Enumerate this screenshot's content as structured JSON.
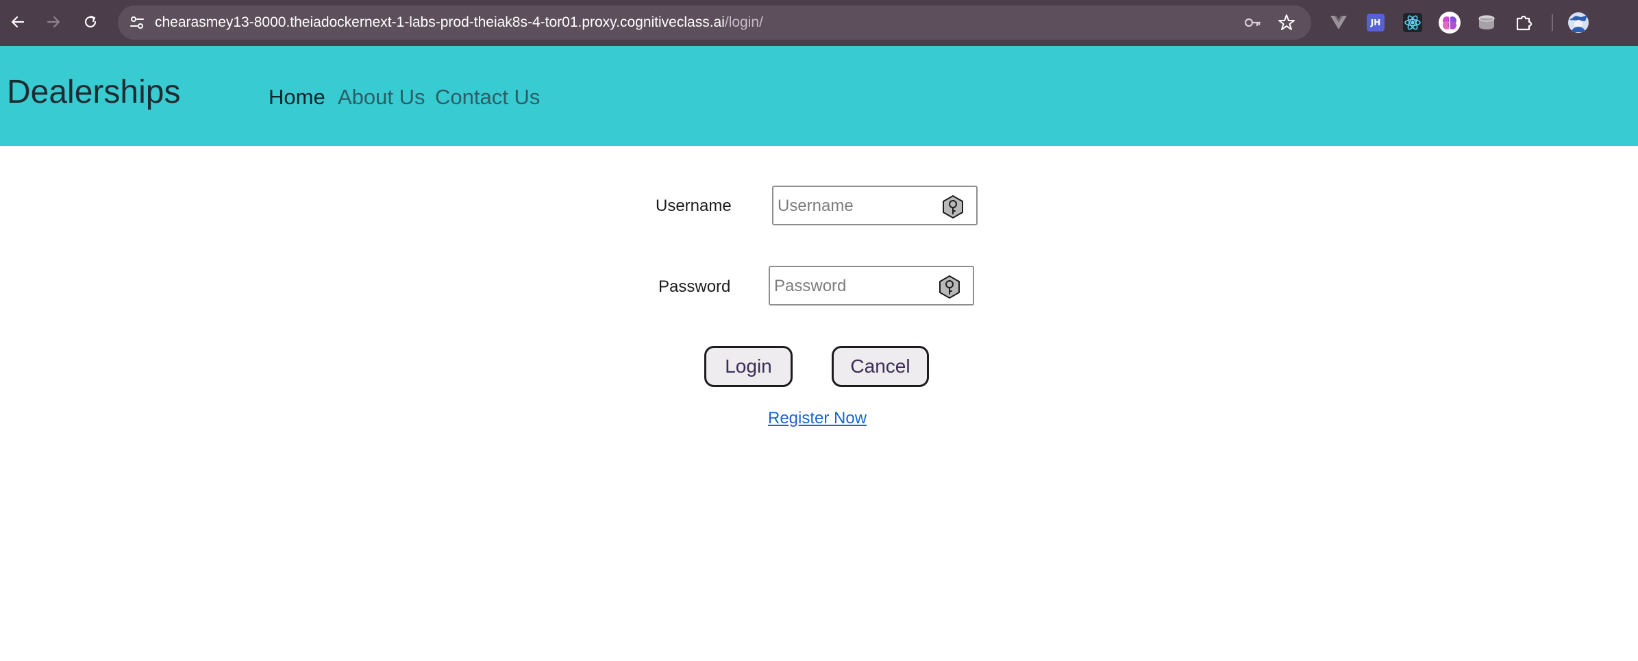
{
  "browser": {
    "url_host": "chearasmey13-8000.theiadockernext-1-labs-prod-theiak8s-4-tor01.proxy.cognitiveclass.ai",
    "url_path": "/login/",
    "icons": [
      "back-icon",
      "forward-icon",
      "reload-icon",
      "site-info-icon",
      "password-key-icon",
      "bookmark-star-icon",
      "vue-devtools-icon",
      "jh-extension-icon",
      "react-devtools-icon",
      "brain-extension-icon",
      "database-extension-icon",
      "extensions-puzzle-icon",
      "profile-avatar-icon"
    ],
    "jh_badge": "JH"
  },
  "site": {
    "brand": "Dealerships",
    "nav": [
      {
        "label": "Home",
        "active": true
      },
      {
        "label": "About Us",
        "active": false
      },
      {
        "label": "Contact Us",
        "active": false
      }
    ],
    "colors": {
      "navbar": "#38ccd2",
      "link": "#1a63d6"
    }
  },
  "login": {
    "username_label": "Username",
    "username_placeholder": "Username",
    "username_value": "",
    "password_label": "Password",
    "password_placeholder": "Password",
    "password_value": "",
    "login_button": "Login",
    "cancel_button": "Cancel",
    "register_link": "Register Now"
  }
}
